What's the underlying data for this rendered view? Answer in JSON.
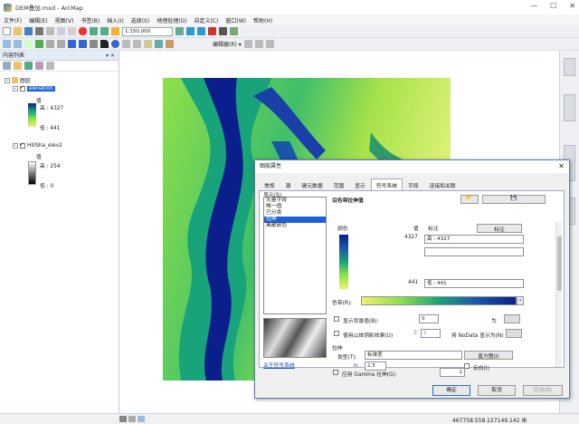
{
  "window": {
    "title": "DEM叠加.mxd - ArcMap",
    "minimize": "—",
    "maximize": "☐",
    "close": "✕"
  },
  "menu": [
    "文件(F)",
    "编辑(E)",
    "视图(V)",
    "书签(B)",
    "插入(I)",
    "选择(S)",
    "地理处理(G)",
    "自定义(C)",
    "窗口(W)",
    "帮助(H)"
  ],
  "toolbar": {
    "scale": "1:150,000",
    "editor_label": "编辑器(R) ▾"
  },
  "toc": {
    "title": "内容列表",
    "pin": "▾ ✕",
    "group": "图层",
    "layer1": {
      "name": "elevation",
      "value_label": "值",
      "high": "高 : 4327",
      "low": "低 : 441"
    },
    "layer2": {
      "name": "HillSha_elev2",
      "value_label": "值",
      "high": "高 : 254",
      "low": "低 : 0"
    }
  },
  "status": {
    "coords": "467758.558  227149.142 米"
  },
  "dialog": {
    "title": "图层属性",
    "close": "✕",
    "tabs": [
      "常规",
      "源",
      "键元数据",
      "范围",
      "显示",
      "符号系统",
      "字段",
      "连接和关联"
    ],
    "active_tab": "符号系统",
    "show_label": "显示(S):",
    "show_items": [
      "矢量字段",
      "唯一值",
      "已分类",
      "拉伸",
      "离散颜色"
    ],
    "selected_item": "拉伸",
    "heading": "沿色带拉伸值",
    "col_color": "颜色",
    "col_value": "值",
    "col_label": "标注",
    "label_button": "标注",
    "val_high": "4327",
    "val_low": "441",
    "label_high": "高 : 4327",
    "label_low": "低 : 441",
    "ramp_label": "色带(R):",
    "bg_label": "显示背景值(B):",
    "bg_value": "0",
    "as_label": "为",
    "hillshade_label": "使用山体阴影效果(U)",
    "z_label": "Z:",
    "z_value": "1",
    "nodata_label": "将 NoData 显示为(N)",
    "stretch_label": "拉伸",
    "type_label": "类型(T):",
    "type_value": "标准差",
    "hist_button": "直方图(I)",
    "n_label": "n:",
    "n_value": "2.5",
    "invert_label": "反向(I)",
    "gamma_label": "应用 Gamma 拉伸(G):",
    "gamma_value": "1",
    "about_link": "关于符号系统",
    "ok": "确定",
    "cancel": "取消",
    "apply": "应用(A)"
  }
}
